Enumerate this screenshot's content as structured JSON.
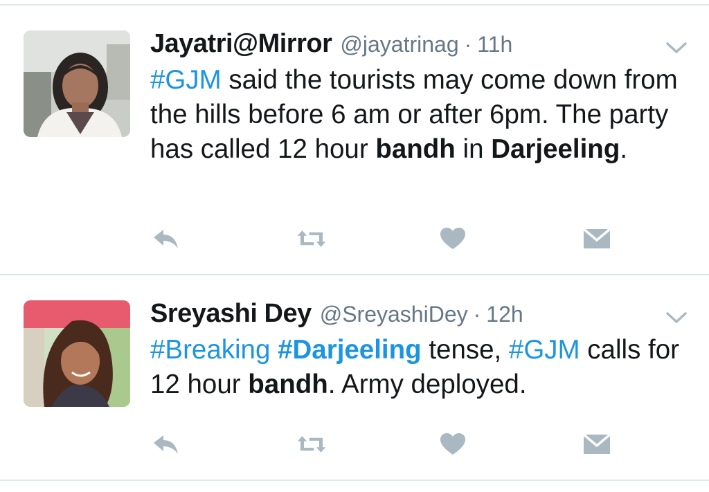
{
  "tweets": [
    {
      "name": "Jayatri@Mirror",
      "handle": "@jayatrinag",
      "separator": "·",
      "time": "11h",
      "text_parts": [
        {
          "t": "#GJM",
          "s": "hashtag"
        },
        {
          "t": " said the tourists may come down from the hills before 6 am or after 6pm. The party has called 12 hour ",
          "s": "plain"
        },
        {
          "t": "bandh",
          "s": "bold"
        },
        {
          "t": " in ",
          "s": "plain"
        },
        {
          "t": "Darjeeling",
          "s": "bold"
        },
        {
          "t": ".",
          "s": "plain"
        }
      ]
    },
    {
      "name": "Sreyashi Dey",
      "handle": "@SreyashiDey",
      "separator": "·",
      "time": "12h",
      "text_parts": [
        {
          "t": "#Breaking",
          "s": "hashtag"
        },
        {
          "t": " ",
          "s": "plain"
        },
        {
          "t": "#Darjeeling",
          "s": "hashtag-bold"
        },
        {
          "t": " tense, ",
          "s": "plain"
        },
        {
          "t": "#GJM",
          "s": "hashtag"
        },
        {
          "t": " calls for 12 hour ",
          "s": "plain"
        },
        {
          "t": "bandh",
          "s": "bold"
        },
        {
          "t": ". Army deployed.",
          "s": "plain"
        }
      ]
    }
  ],
  "icons": {
    "caret": "chevron-down-icon",
    "reply": "reply-icon",
    "retweet": "retweet-icon",
    "like": "heart-icon",
    "dm": "envelope-icon"
  },
  "colors": {
    "hashtag": "#1b95e0",
    "meta": "#657786",
    "icon": "#aab8c2",
    "divider": "#e1e8ed"
  }
}
